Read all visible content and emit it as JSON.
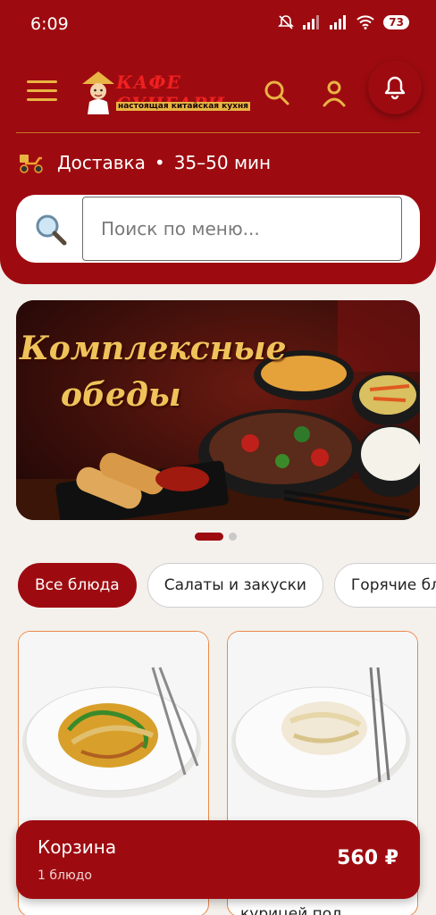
{
  "status_bar": {
    "time": "6:09",
    "battery": "73"
  },
  "header": {
    "logo_title": "КАФЕ СУНГАРИ",
    "logo_subtitle": "настоящая китайская кухня"
  },
  "delivery": {
    "label": "Доставка",
    "separator": "•",
    "time": "35–50 мин"
  },
  "search": {
    "placeholder": "Поиск по меню..."
  },
  "banner": {
    "line1": "Комплексные",
    "line2": "обеды",
    "slide_index": 1,
    "slide_count": 2
  },
  "categories": [
    {
      "label": "Все блюда",
      "active": true
    },
    {
      "label": "Салаты и закуски",
      "active": false
    },
    {
      "label": "Горячие блюда",
      "active": false
    }
  ],
  "products": [
    {
      "name": ""
    },
    {
      "name": "курицей под"
    }
  ],
  "cart": {
    "title": "Корзина",
    "count": "1 блюдо",
    "total": "560 ₽"
  },
  "colors": {
    "primary": "#9d0b10",
    "accent": "#e9b443",
    "background": "#f4f0ec"
  },
  "icons": [
    "menu-icon",
    "search-icon",
    "user-icon",
    "bell-icon",
    "scooter-icon",
    "magnifier-icon"
  ]
}
